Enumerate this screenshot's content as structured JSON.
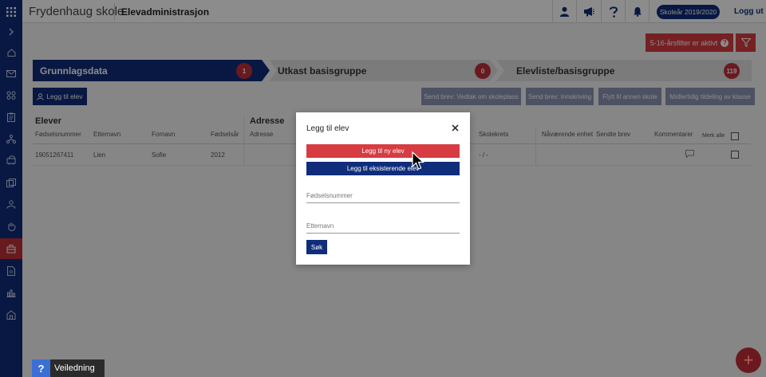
{
  "topbar": {
    "school_name": "Frydenhaug skole",
    "app_name": "Elevadministrasjon",
    "school_year": "Skoleår 2019/2020",
    "logout": "Logg ut"
  },
  "filter": {
    "warning": "5-16-årsfilter er aktivt",
    "help_glyph": "?"
  },
  "steps": [
    {
      "label": "Grunnlagsdata",
      "count": "1"
    },
    {
      "label": "Utkast basisgruppe",
      "count": "0"
    },
    {
      "label": "Elevliste/basisgruppe",
      "count": "119"
    }
  ],
  "actions": {
    "add_student": "Legg til elev",
    "send_letter_decision": "Send brev: Vedtak om skoleplass",
    "send_letter_enrollment": "Send brev: Innskriving",
    "move_school": "Flytt til annen skole",
    "temp_class": "Midlertidig tildeling av klasse"
  },
  "table": {
    "section_students": "Elever",
    "section_address": "Adresse",
    "columns": {
      "birth_number": "Fødselsnummer",
      "last_name": "Etternavn",
      "first_name": "Fornavn",
      "birth_year": "Fødselsår",
      "address": "Adresse",
      "school_district": "Skolekrets",
      "current_unit": "Nåværende enhet",
      "sent_letters": "Sendte brev",
      "comments": "Kommentarer",
      "select_all": "Merk alle"
    },
    "rows": [
      {
        "birth_number": "19051267411",
        "last_name": "Lien",
        "first_name": "Sofie",
        "birth_year": "2012",
        "school_district": "- / -"
      }
    ]
  },
  "modal": {
    "title": "Legg til elev",
    "new_student": "Legg til ny elev",
    "existing_student": "Legg til eksisterende elev",
    "birth_number_placeholder": "Fødselsnummer",
    "last_name_placeholder": "Etternavn",
    "search": "Søk"
  },
  "help": {
    "glyph": "?",
    "label": "Veiledning"
  },
  "fab": {
    "glyph": "+"
  },
  "colors": {
    "navy": "#0f2d7a",
    "red": "#d63c41",
    "sidebar_active": "#c0303a"
  }
}
